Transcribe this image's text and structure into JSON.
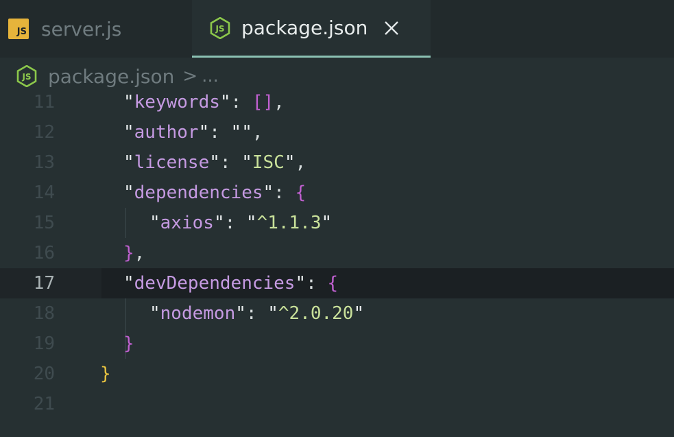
{
  "tabs": {
    "server": {
      "label": "server.js",
      "icon": "js-icon",
      "icon_text": "JS"
    },
    "package": {
      "label": "package.json",
      "icon": "node-icon",
      "close": "close-icon"
    }
  },
  "breadcrumb": {
    "file": "package.json",
    "separator": ">",
    "more": "..."
  },
  "colors": {
    "key": "#c59ae2",
    "string": "#c9e19a",
    "brace_outer": "#e8c340",
    "brace_inner": "#c060d0",
    "active_tab_underline": "#8bc1b3"
  },
  "editor": {
    "current_line": "17",
    "lines": [
      {
        "num": "11",
        "key": "keywords",
        "after_key": ": ",
        "value_open": "[]",
        "trail": ","
      },
      {
        "num": "12",
        "key": "author",
        "after_key": ": ",
        "value": "",
        "trail": ","
      },
      {
        "num": "13",
        "key": "license",
        "after_key": ": ",
        "value": "ISC",
        "trail": ","
      },
      {
        "num": "14",
        "key": "dependencies",
        "after_key": ": ",
        "brace": "{"
      },
      {
        "num": "15",
        "key": "axios",
        "after_key": ": ",
        "value": "^1.1.3"
      },
      {
        "num": "16",
        "brace": "}",
        "trail": ","
      },
      {
        "num": "17",
        "key": "devDependencies",
        "after_key": ": ",
        "brace": "{"
      },
      {
        "num": "18",
        "key": "nodemon",
        "after_key": ": ",
        "value": "^2.0.20"
      },
      {
        "num": "19",
        "brace": "}"
      },
      {
        "num": "20",
        "brace": "}"
      },
      {
        "num": "21"
      }
    ]
  }
}
